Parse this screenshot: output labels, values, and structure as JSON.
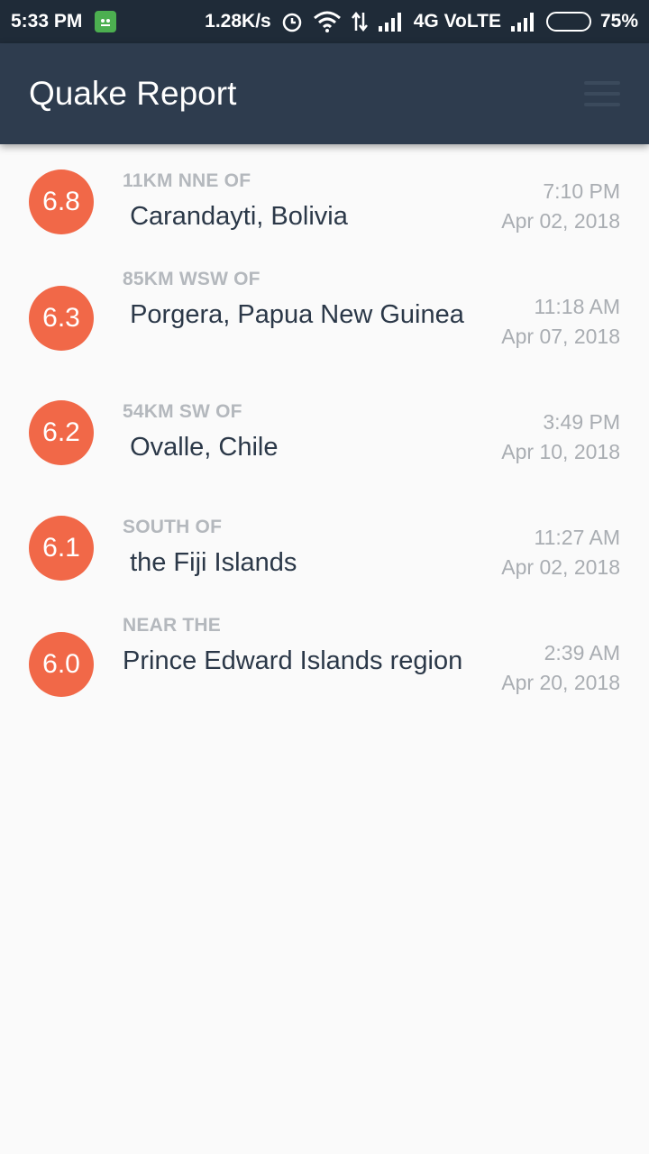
{
  "status_bar": {
    "time": "5:33 PM",
    "speed": "1.28K/s",
    "network": "4G VoLTE",
    "battery": "75%",
    "battery_level": 0.75
  },
  "app_bar": {
    "title": "Quake Report",
    "menu_icon": "menu-icon"
  },
  "colors": {
    "app_bar": "#2e3c4e",
    "status_bar": "#1f2b38",
    "magnitude_circle": "#f16848",
    "primary_text": "#2b3848",
    "secondary_text": "#b4b8bd"
  },
  "quakes": [
    {
      "magnitude": "6.8",
      "offset": "11KM NNE OF",
      "primary": " Carandayti, Bolivia",
      "time": "7:10 PM",
      "date": "Apr 02, 2018"
    },
    {
      "magnitude": "6.3",
      "offset": "85KM WSW OF",
      "primary": " Porgera, Papua New Guinea",
      "time": "11:18 AM",
      "date": "Apr 07, 2018"
    },
    {
      "magnitude": "6.2",
      "offset": "54KM SW OF",
      "primary": " Ovalle, Chile",
      "time": "3:49 PM",
      "date": "Apr 10, 2018"
    },
    {
      "magnitude": "6.1",
      "offset": "SOUTH OF",
      "primary": " the Fiji Islands",
      "time": "11:27 AM",
      "date": "Apr 02, 2018"
    },
    {
      "magnitude": "6.0",
      "offset": "NEAR THE",
      "primary": "Prince Edward Islands region",
      "time": "2:39 AM",
      "date": "Apr 20, 2018"
    }
  ]
}
